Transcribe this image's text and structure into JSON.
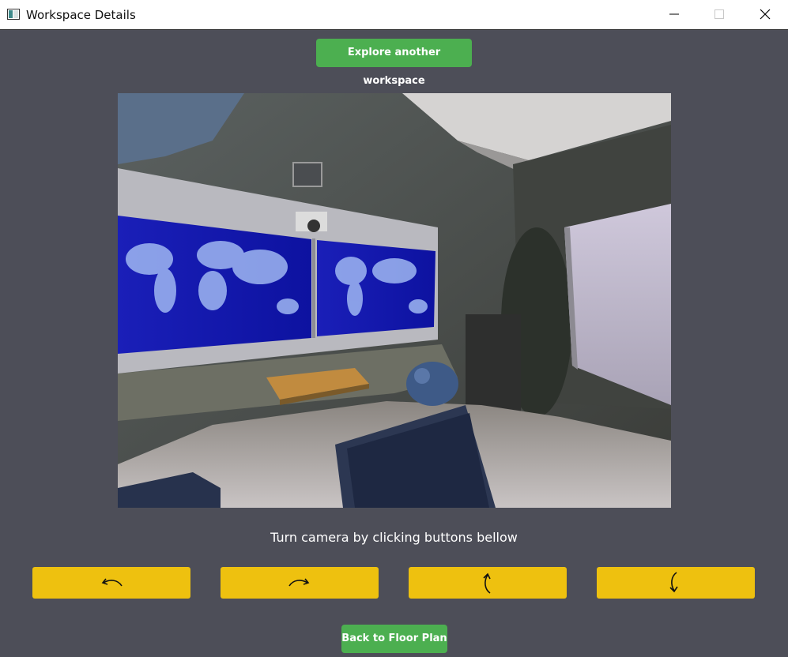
{
  "window": {
    "title": "Workspace Details",
    "controls": [
      "minimize",
      "maximize",
      "close"
    ]
  },
  "header": {
    "explore_label": "Explore another workspace"
  },
  "camera": {
    "image_alt": "360 camera view of meeting room with world map screens"
  },
  "instruction": "Turn camera by clicking buttons bellow",
  "turn_buttons": [
    {
      "icon": "rotate-left-icon"
    },
    {
      "icon": "rotate-right-icon"
    },
    {
      "icon": "rotate-up-icon"
    },
    {
      "icon": "rotate-down-icon"
    }
  ],
  "footer": {
    "back_label": "Back to Floor Plan"
  },
  "colors": {
    "background": "#4d4e58",
    "green_button": "#4caf50",
    "yellow_button": "#eec10f",
    "titlebar": "#ffffff"
  }
}
